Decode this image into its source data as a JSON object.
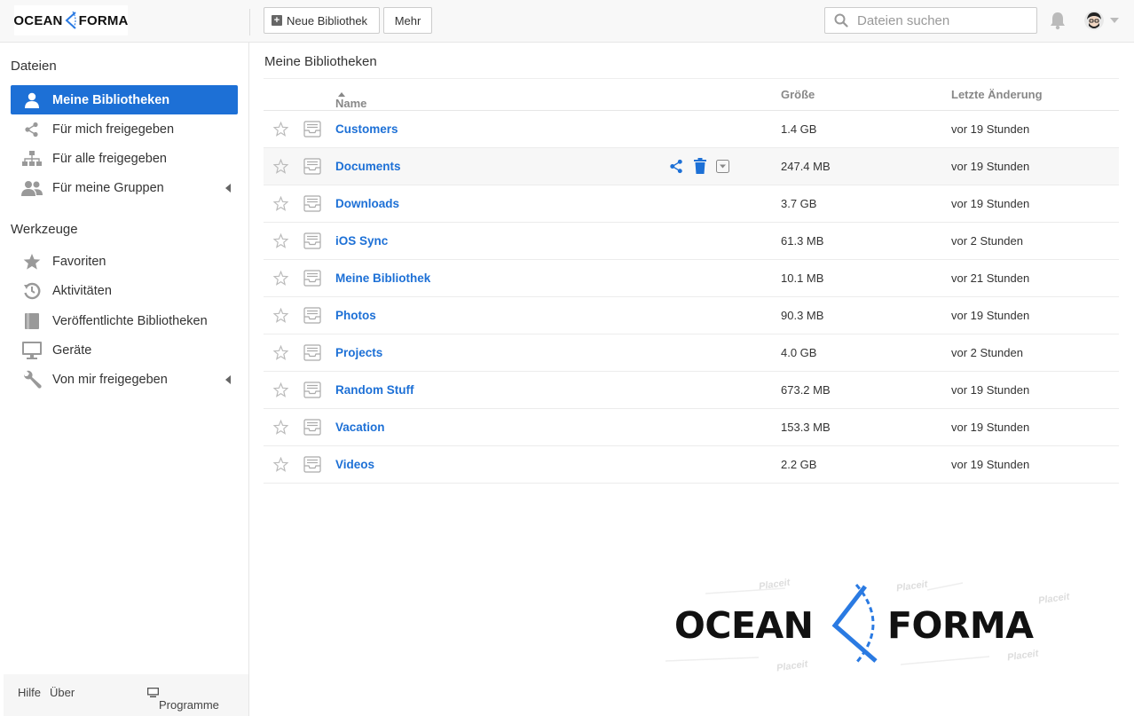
{
  "header": {
    "logo": {
      "left": "OCEAN",
      "right": "FORMA"
    },
    "new_library_label": "Neue Bibliothek",
    "more_label": "Mehr",
    "search_placeholder": "Dateien suchen"
  },
  "sidebar": {
    "files_heading": "Dateien",
    "file_items": [
      {
        "label": "Meine Bibliotheken",
        "icon": "user-icon",
        "active": true
      },
      {
        "label": "Für mich freigegeben",
        "icon": "share-icon"
      },
      {
        "label": "Für alle freigegeben",
        "icon": "org-chart-icon"
      },
      {
        "label": "Für meine Gruppen",
        "icon": "group-icon",
        "expandable": true
      }
    ],
    "tools_heading": "Werkzeuge",
    "tool_items": [
      {
        "label": "Favoriten",
        "icon": "star-icon"
      },
      {
        "label": "Aktivitäten",
        "icon": "history-icon"
      },
      {
        "label": "Veröffentlichte Bibliotheken",
        "icon": "book-icon"
      },
      {
        "label": "Geräte",
        "icon": "monitor-icon"
      },
      {
        "label": "Von mir freigegeben",
        "icon": "wrench-icon",
        "expandable": true
      }
    ],
    "footer": {
      "help": "Hilfe",
      "about": "Über",
      "apps": "Programme"
    }
  },
  "main": {
    "breadcrumb": "Meine Bibliotheken",
    "columns": {
      "name": "Name",
      "size": "Größe",
      "modified": "Letzte Änderung"
    },
    "rows": [
      {
        "name": "Customers",
        "size": "1.4 GB",
        "modified": "vor 19 Stunden"
      },
      {
        "name": "Documents",
        "size": "247.4 MB",
        "modified": "vor 19 Stunden"
      },
      {
        "name": "Downloads",
        "size": "3.7 GB",
        "modified": "vor 19 Stunden"
      },
      {
        "name": "iOS Sync",
        "size": "61.3 MB",
        "modified": "vor 2 Stunden"
      },
      {
        "name": "Meine Bibliothek",
        "size": "10.1 MB",
        "modified": "vor 21 Stunden"
      },
      {
        "name": "Photos",
        "size": "90.3 MB",
        "modified": "vor 19 Stunden"
      },
      {
        "name": "Projects",
        "size": "4.0 GB",
        "modified": "vor 2 Stunden"
      },
      {
        "name": "Random Stuff",
        "size": "673.2 MB",
        "modified": "vor 19 Stunden"
      },
      {
        "name": "Vacation",
        "size": "153.3 MB",
        "modified": "vor 19 Stunden"
      },
      {
        "name": "Videos",
        "size": "2.2 GB",
        "modified": "vor 19 Stunden"
      }
    ],
    "hover_row": 1
  },
  "watermark": {
    "left": "OCEAN",
    "right": "FORMA",
    "stamp": "Placeit"
  },
  "colors": {
    "accent": "#1d70d6",
    "logo_blue": "#2a7ae2"
  }
}
